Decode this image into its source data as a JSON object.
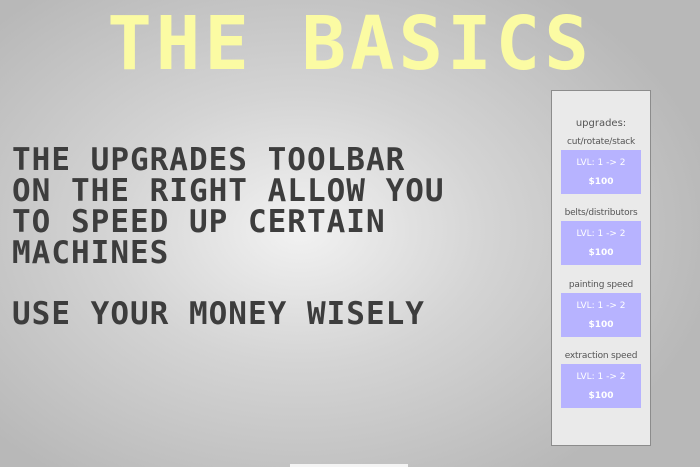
{
  "title": "THE BASICS",
  "body": {
    "paragraph1_lines": [
      "THE UPGRADES TOOLBAR",
      "ON THE RIGHT ALLOW YOU",
      "TO SPEED UP CERTAIN",
      "MACHINES"
    ],
    "paragraph2": "USE YOUR MONEY WISELY"
  },
  "upgrades_panel": {
    "title": "upgrades:",
    "items": [
      {
        "label": "cut/rotate/stack",
        "level": "LVL: 1 -> 2",
        "price": "$100"
      },
      {
        "label": "belts/distributors",
        "level": "LVL: 1 -> 2",
        "price": "$100"
      },
      {
        "label": "painting speed",
        "level": "LVL: 1 -> 2",
        "price": "$100"
      },
      {
        "label": "extraction speed",
        "level": "LVL: 1 -> 2",
        "price": "$100"
      }
    ]
  },
  "colors": {
    "title": "#fbfba3",
    "body_text": "#3d3d3d",
    "upgrade_button": "#b7b3ff"
  }
}
